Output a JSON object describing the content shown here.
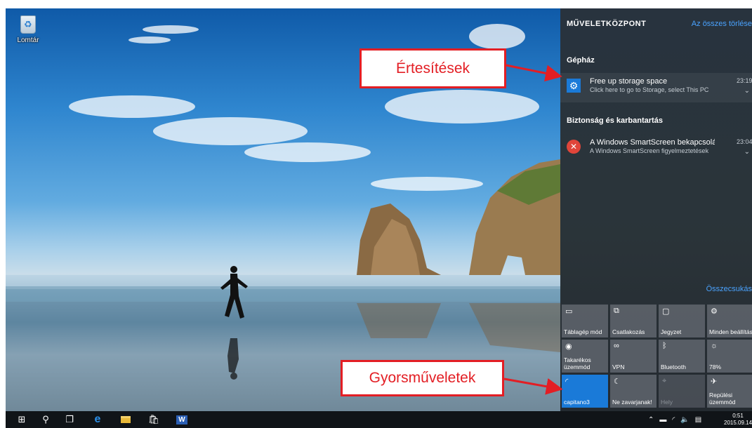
{
  "desktop": {
    "recycle_bin_label": "Lomtár"
  },
  "action_center": {
    "title": "MŰVELETKÖZPONT",
    "clear_all": "Az összes törlése",
    "groups": [
      {
        "title": "Gépház",
        "notification": {
          "title": "Free up storage space",
          "body": "Click here to go to Storage, select This PC",
          "time": "23:19",
          "icon": "gear-icon"
        }
      },
      {
        "title": "Biztonság és karbantartás",
        "notification": {
          "title": "A Windows SmartScreen bekapcsolása",
          "body": "A Windows SmartScreen figyelmeztetések",
          "time": "23:04",
          "icon": "error-icon"
        }
      }
    ],
    "collapse": "Összecsukás"
  },
  "quick_actions": [
    {
      "label": "Táblagép mód",
      "icon": "tablet-mode-icon",
      "state": "normal"
    },
    {
      "label": "Csatlakozás",
      "icon": "connect-icon",
      "state": "normal"
    },
    {
      "label": "Jegyzet",
      "icon": "note-icon",
      "state": "normal"
    },
    {
      "label": "Minden beállítás",
      "icon": "settings-icon",
      "state": "normal"
    },
    {
      "label": "Takarékos üzemmód",
      "icon": "battery-saver-icon",
      "state": "normal"
    },
    {
      "label": "VPN",
      "icon": "vpn-icon",
      "state": "normal"
    },
    {
      "label": "Bluetooth",
      "icon": "bluetooth-icon",
      "state": "normal"
    },
    {
      "label": "78%",
      "icon": "brightness-icon",
      "state": "normal"
    },
    {
      "label": "capitano3",
      "icon": "wifi-icon",
      "state": "active"
    },
    {
      "label": "Ne zavarjanak!",
      "icon": "quiet-hours-icon",
      "state": "normal"
    },
    {
      "label": "Hely",
      "icon": "location-icon",
      "state": "disabled"
    },
    {
      "label": "Repülési üzemmód",
      "icon": "airplane-icon",
      "state": "normal"
    }
  ],
  "taskbar": {
    "clock_time": "0:51",
    "clock_date": "2015.09.14."
  },
  "callouts": {
    "notifications": "Értesítések",
    "quick_actions": "Gyorsműveletek"
  },
  "colors": {
    "accent": "#1a7ad8",
    "callout_red": "#e31e24",
    "link_blue": "#4aa3ff"
  }
}
